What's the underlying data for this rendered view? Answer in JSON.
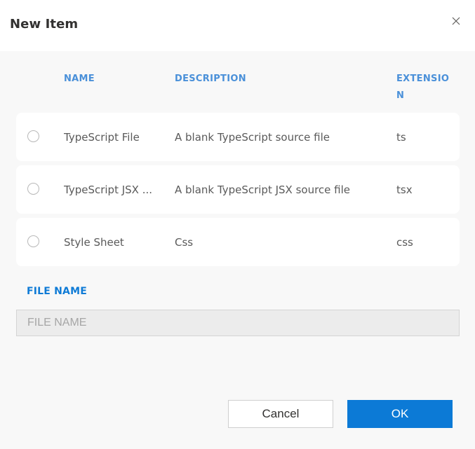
{
  "dialog": {
    "title": "New Item"
  },
  "columns": {
    "name": "NAME",
    "description": "DESCRIPTION",
    "extension": "EXTENSION"
  },
  "items": [
    {
      "name": "TypeScript File",
      "description": "A blank TypeScript source file",
      "extension": "ts"
    },
    {
      "name": "TypeScript JSX ...",
      "description": "A blank TypeScript JSX source file",
      "extension": "tsx"
    },
    {
      "name": "Style Sheet",
      "description": "Css",
      "extension": "css"
    }
  ],
  "file_name": {
    "label": "FILE NAME",
    "placeholder": "FILE NAME",
    "value": ""
  },
  "buttons": {
    "cancel": "Cancel",
    "ok": "OK"
  },
  "icons": {
    "close": "close-icon",
    "radio": "radio-icon"
  },
  "colors": {
    "accent": "#0c7ad6",
    "header_text": "#4a90d9",
    "background": "#f8f8f8"
  }
}
